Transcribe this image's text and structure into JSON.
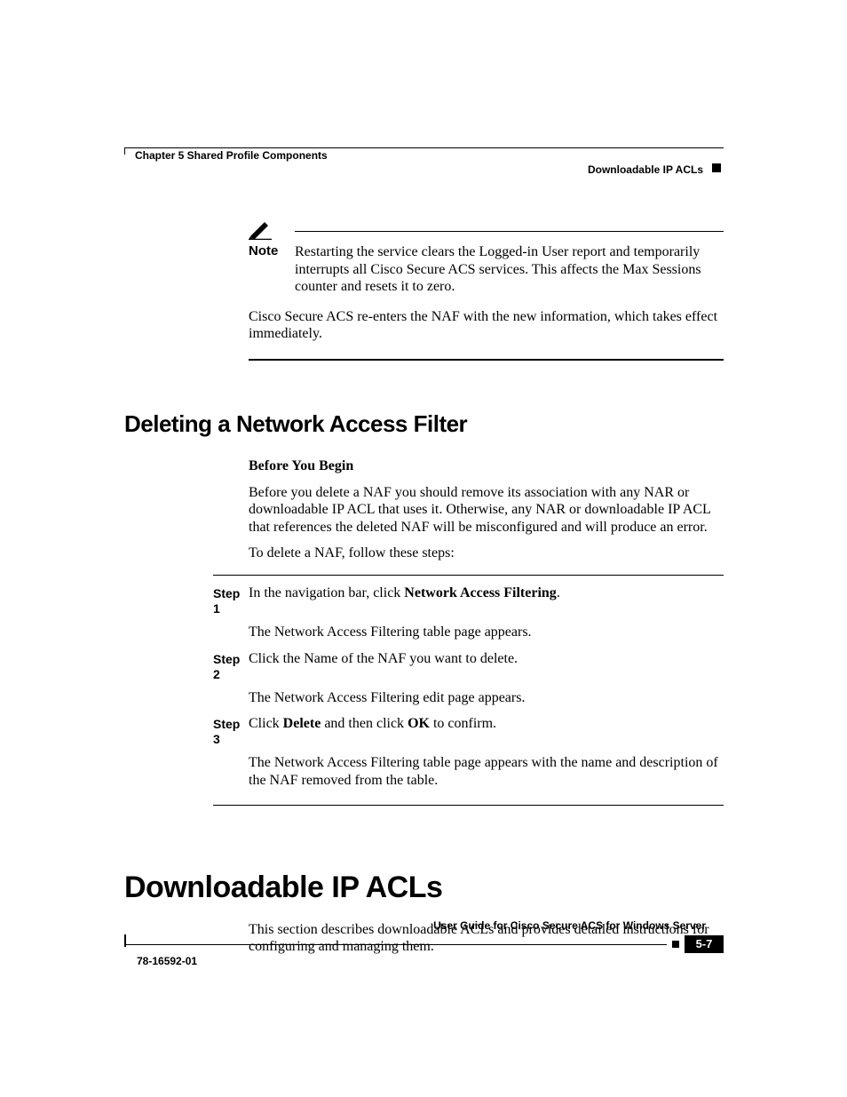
{
  "header": {
    "chapter": "Chapter 5      Shared Profile Components",
    "section": "Downloadable IP ACLs"
  },
  "note": {
    "label": "Note",
    "text": "Restarting the service clears the Logged-in User report and temporarily interrupts all Cisco Secure ACS services. This affects the Max Sessions counter and resets it to zero."
  },
  "para_after_note": "Cisco Secure ACS re-enters the NAF with the new information, which takes effect immediately.",
  "h2": "Deleting a Network Access Filter",
  "before_begin": {
    "label": "Before You Begin",
    "p1": "Before you delete a NAF you should remove its association with any NAR or downloadable IP ACL that uses it. Otherwise, any NAR or downloadable IP ACL that references the deleted NAF will be misconfigured and will produce an error.",
    "p2": "To delete a NAF, follow these steps:"
  },
  "steps": [
    {
      "label": "Step 1",
      "line1_pre": "In the navigation bar, click ",
      "line1_bold": "Network Access Filtering",
      "line1_post": ".",
      "line2": "The Network Access Filtering table page appears."
    },
    {
      "label": "Step 2",
      "line1_pre": "Click the Name of the NAF you want to delete.",
      "line1_bold": "",
      "line1_post": "",
      "line2": "The Network Access Filtering edit page appears."
    },
    {
      "label": "Step 3",
      "line1_pre": "Click ",
      "line1_bold": "Delete",
      "line1_mid": " and then click ",
      "line1_bold2": "OK",
      "line1_post": " to confirm.",
      "line2": "The Network Access Filtering table page appears with the name and description of the NAF removed from the table."
    }
  ],
  "h1": "Downloadable IP ACLs",
  "main_para": "This section describes downloadable ACLs and provides detailed instructions for configuring and managing them.",
  "footer": {
    "guide": "User Guide for Cisco Secure ACS for Windows Server",
    "docnum": "78-16592-01",
    "page": "5-7"
  }
}
